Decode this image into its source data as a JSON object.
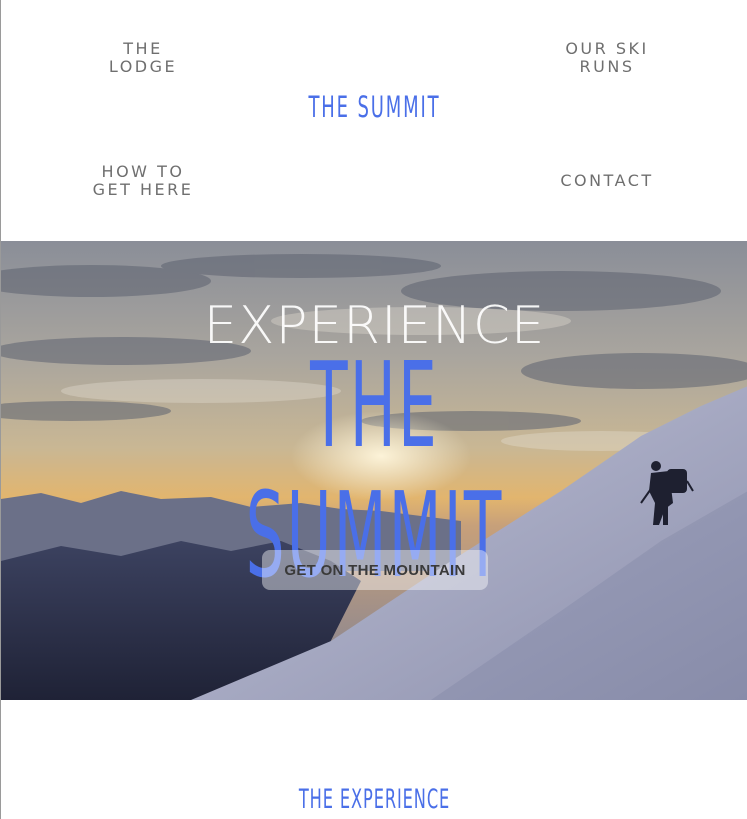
{
  "nav": {
    "lodge": "THE LODGE",
    "ski_runs": "OUR SKI RUNS",
    "how_to_get_here": "HOW TO GET HERE",
    "contact": "CONTACT"
  },
  "brand": {
    "name": "THE SUMMIT"
  },
  "hero": {
    "subtitle": "EXPERIENCE",
    "title": "THE SUMMIT",
    "cta_label": "GET ON THE MOUNTAIN",
    "image": "mountain-climber-sunset-photo"
  },
  "section": {
    "heading": "THE EXPERIENCE"
  },
  "colors": {
    "accent": "#4a6fe8",
    "nav_text": "#6f6f6f"
  }
}
